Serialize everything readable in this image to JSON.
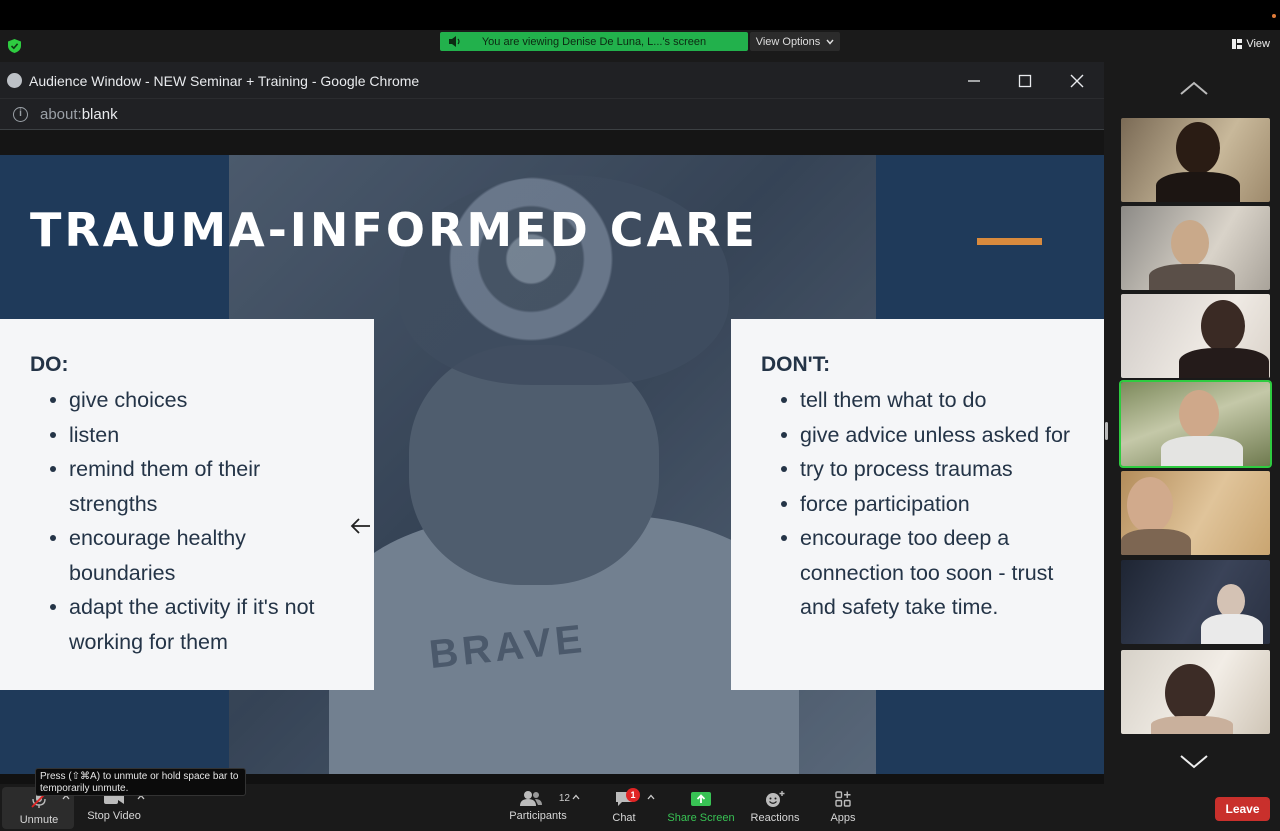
{
  "zoom_header": {
    "share_banner": "You are viewing Denise De Luna, L...'s screen",
    "view_options": "View Options",
    "view": "View"
  },
  "chrome": {
    "window_title": "Audience Window - NEW Seminar + Training - Google Chrome",
    "url_scheme": "about:",
    "url_path": "blank",
    "info_glyph": "i"
  },
  "slide": {
    "title": "TRAUMA-INFORMED CARE",
    "photo_shirt_text": "BRAVE",
    "do_heading": "DO:",
    "do_items": [
      "give choices",
      "listen",
      "remind them of their strengths",
      "encourage healthy boundaries",
      "adapt the activity if it's not working for them"
    ],
    "dont_heading": "DON'T:",
    "dont_items": [
      "tell them what to do",
      "give advice unless asked for",
      "try to process traumas",
      "force participation",
      "encourage too deep a connection too soon - trust and safety take time."
    ],
    "accent_color": "#d98a3d",
    "background_color": "#1f3a5a"
  },
  "gallery": {
    "tile_count": 7,
    "active_tile": 4
  },
  "toolbar": {
    "unmute": "Unmute",
    "stop_video": "Stop Video",
    "participants": "Participants",
    "participants_count": "12",
    "chat": "Chat",
    "chat_badge": "1",
    "share_screen": "Share Screen",
    "reactions": "Reactions",
    "apps": "Apps",
    "leave": "Leave",
    "tooltip": "Press  (⇧⌘A) to unmute or hold space bar to temporarily unmute.",
    "share_color": "#38c254",
    "leave_color": "#c9302c"
  }
}
